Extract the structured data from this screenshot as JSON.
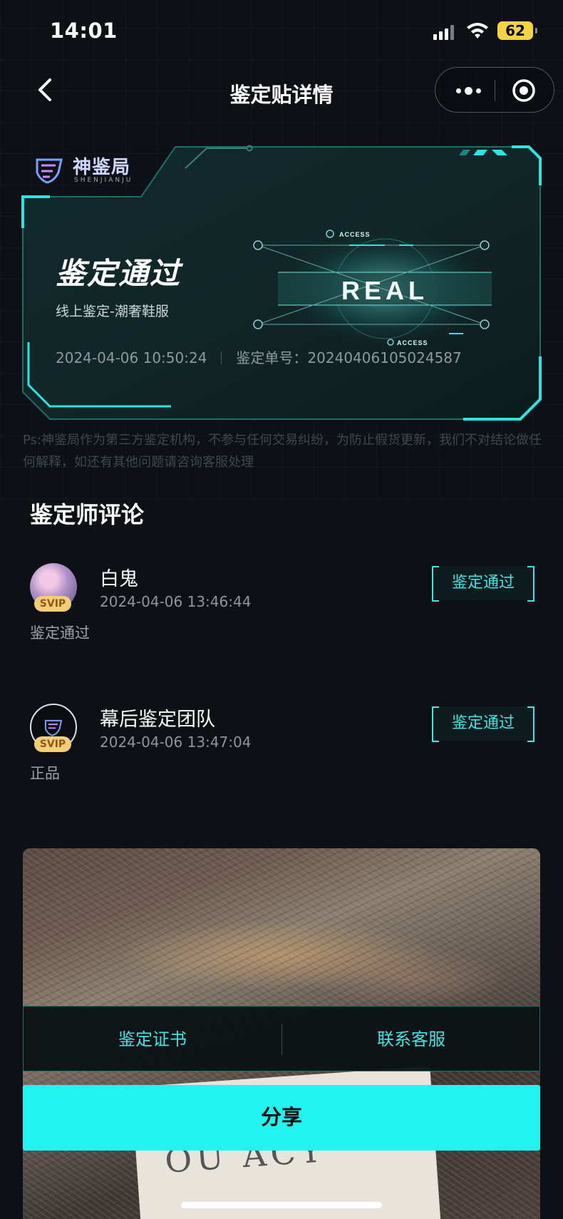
{
  "status_bar": {
    "time": "14:01",
    "battery": "62"
  },
  "nav": {
    "title": "鉴定贴详情"
  },
  "result": {
    "logo_text": "神鉴局",
    "logo_sub": "SHENJIANJU",
    "status": "鉴定通过",
    "category": "线上鉴定-潮奢鞋服",
    "datetime": "2024-04-06 10:50:24",
    "order_label": "鉴定单号：",
    "order_no": "20240406105024587",
    "badge_text": "REAL",
    "badge_top": "ACCESS",
    "badge_bottom": "ACCESS"
  },
  "disclaimer": "Ps:神鉴局作为第三方鉴定机构，不参与任何交易纠纷，为防止假货更新，我们不对结论做任何解释，如还有其他问题请咨询客服处理",
  "comments_section": {
    "title": "鉴定师评论",
    "items": [
      {
        "name": "白鬼",
        "time": "2024-04-06 13:46:44",
        "text": "鉴定通过",
        "tag": "鉴定通过",
        "badge": "SVIP"
      },
      {
        "name": "幕后鉴定团队",
        "time": "2024-04-06 13:47:04",
        "text": "正品",
        "tag": "鉴定通过",
        "badge": "SVIP"
      }
    ]
  },
  "photo": {
    "label_text": "OU ACY"
  },
  "actions": {
    "certificate": "鉴定证书",
    "contact": "联系客服",
    "share": "分享"
  },
  "colors": {
    "accent": "#21f3ef",
    "background": "#0d1116",
    "svip": "#f3cd78"
  }
}
